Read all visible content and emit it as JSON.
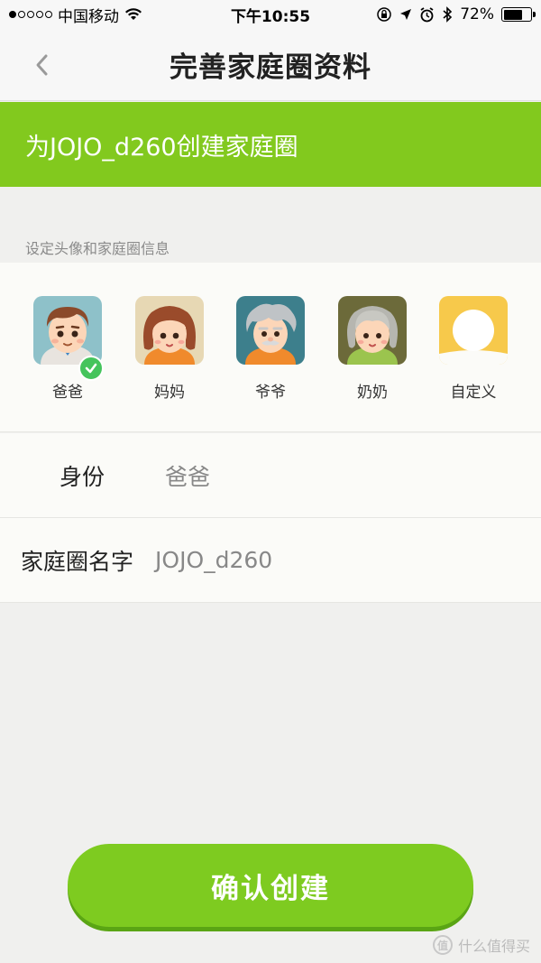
{
  "status_bar": {
    "carrier": "中国移动",
    "time": "下午10:55",
    "battery_percent": "72%",
    "battery_level": 0.72
  },
  "nav": {
    "title": "完善家庭圈资料"
  },
  "banner": {
    "text": "为JOJO_d260创建家庭圈",
    "color": "#82c91e"
  },
  "section_label": "设定头像和家庭圈信息",
  "avatars": [
    {
      "name": "爸爸",
      "selected": true
    },
    {
      "name": "妈妈",
      "selected": false
    },
    {
      "name": "爷爷",
      "selected": false
    },
    {
      "name": "奶奶",
      "selected": false
    },
    {
      "name": "自定义",
      "selected": false
    }
  ],
  "form": {
    "identity_label": "身份",
    "identity_value": "爸爸",
    "family_name_label": "家庭圈名字",
    "family_name_value": "JOJO_d260"
  },
  "confirm_button": {
    "label": "确认创建",
    "color": "#7ecb20"
  },
  "watermark": {
    "text": "什么值得买",
    "logo_char": "值"
  }
}
